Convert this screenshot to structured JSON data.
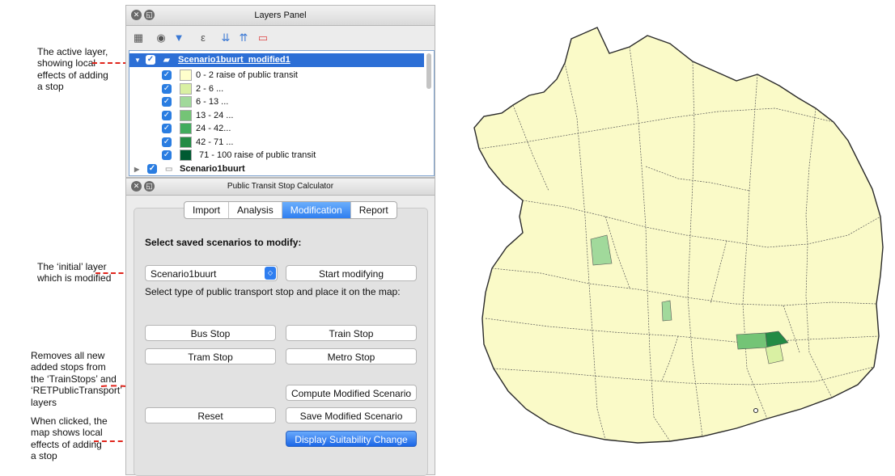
{
  "annotations": {
    "active_layer": [
      "The active layer,",
      "showing local",
      "effects of adding",
      "a stop"
    ],
    "initial_layer": [
      "The ‘initial’ layer",
      "which is modified"
    ],
    "reset_note": [
      "Removes all new",
      "added stops from",
      "the ‘TrainStops’ and",
      "‘RETPublicTransport’",
      "layers"
    ],
    "display_note": [
      "When clicked, the",
      "map shows local",
      "effects of adding",
      "a stop"
    ]
  },
  "layers_panel": {
    "title": "Layers Panel",
    "layers": [
      {
        "name": "Scenario1buurt_modified1",
        "active": true,
        "expanded": true,
        "checked": true,
        "legend": [
          {
            "label": "0 - 2 raise of public transit",
            "color": "#ffffcc",
            "checked": true
          },
          {
            "label": "2 - 6 ...",
            "color": "#d9f0a3",
            "checked": true
          },
          {
            "label": "6 - 13 ...",
            "color": "#a1d99b",
            "checked": true
          },
          {
            "label": "13 - 24 ...",
            "color": "#74c476",
            "checked": true
          },
          {
            "label": "24 - 42...",
            "color": "#41ab5d",
            "checked": true
          },
          {
            "label": "42 - 71 ...",
            "color": "#238b45",
            "checked": true
          },
          {
            "label": "71 - 100 raise of public transit",
            "color": "#005a32",
            "checked": true
          }
        ]
      },
      {
        "name": "Scenario1buurt",
        "active": false,
        "expanded": false,
        "checked": true
      }
    ]
  },
  "calculator": {
    "title": "Public Transit Stop Calculator",
    "tabs": [
      {
        "label": "Import",
        "active": false
      },
      {
        "label": "Analysis",
        "active": false
      },
      {
        "label": "Modification",
        "active": true
      },
      {
        "label": "Report",
        "active": false
      }
    ],
    "heading": "Select saved scenarios to modify:",
    "scenario_select": "Scenario1buurt",
    "start_button": "Start modifying",
    "stop_type_label": "Select type of public transport stop and place it on the map:",
    "stop_buttons": [
      "Bus Stop",
      "Train Stop",
      "Tram Stop",
      "Metro Stop"
    ],
    "compute_button": "Compute Modified Scenario",
    "reset_button": "Reset",
    "save_button": "Save Modified Scenario",
    "display_button": "Display Suitability Change"
  },
  "colors": {
    "map_fill": "#fafac8",
    "map_stroke": "#2a2a2a",
    "active_highlight": "#2c6fd6",
    "annotation_arrow": "#e0261d"
  }
}
